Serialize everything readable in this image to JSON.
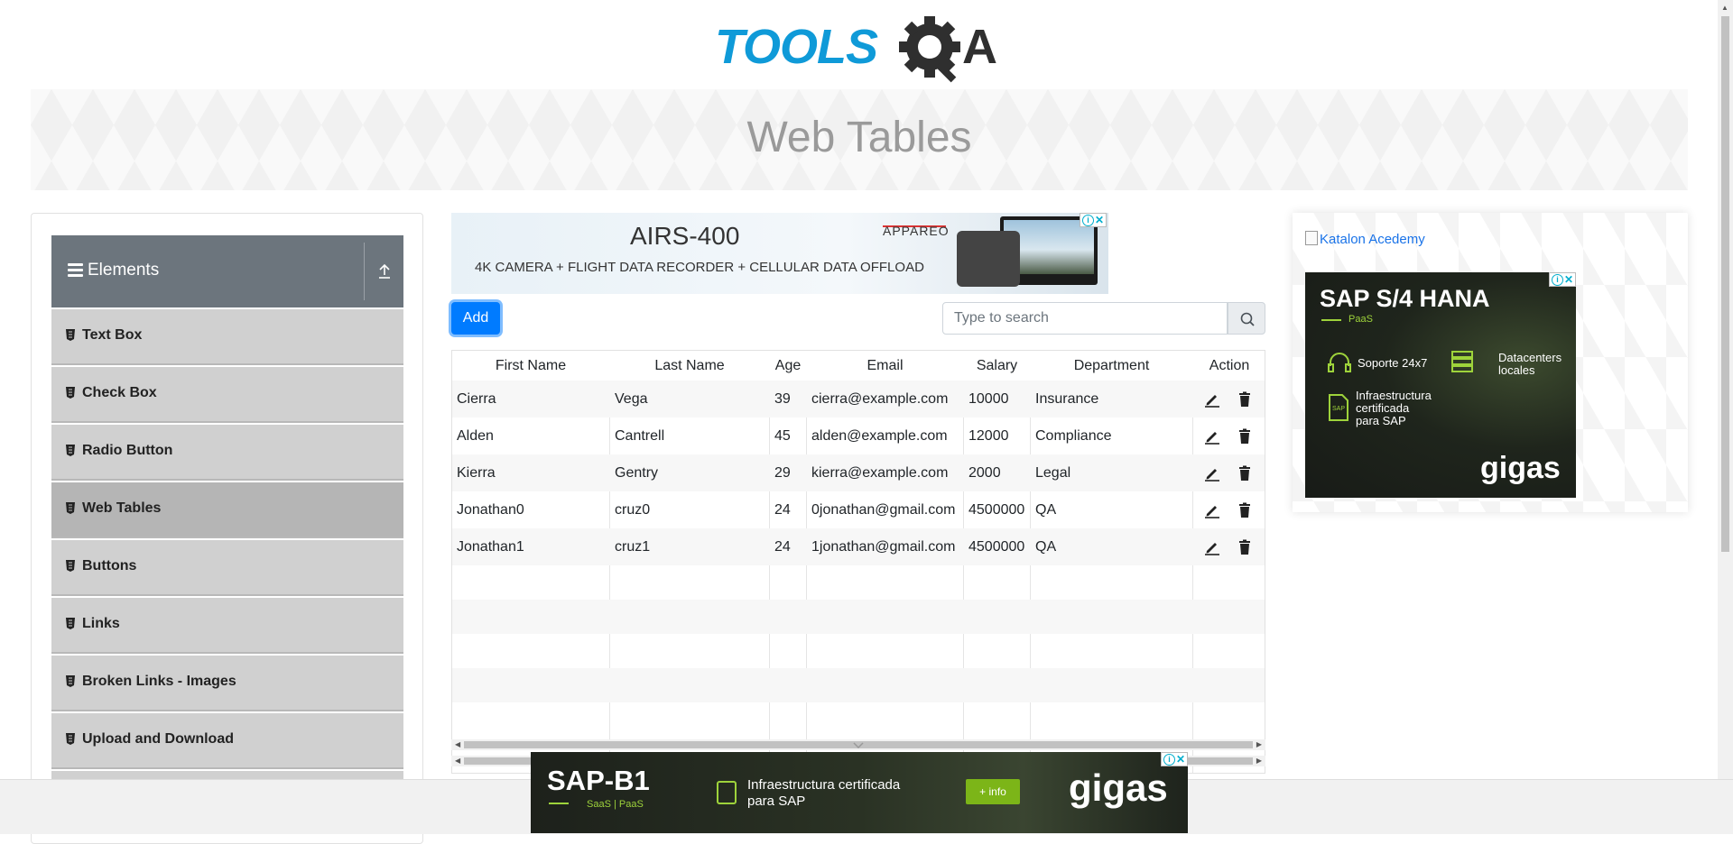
{
  "header": {
    "logo_text_left": "TOOLS",
    "logo_text_right": "A"
  },
  "banner": {
    "title": "Web Tables"
  },
  "sidebar": {
    "group_title": "Elements",
    "items": [
      {
        "label": "Text Box"
      },
      {
        "label": "Check Box"
      },
      {
        "label": "Radio Button"
      },
      {
        "label": "Web Tables",
        "active": true
      },
      {
        "label": "Buttons"
      },
      {
        "label": "Links"
      },
      {
        "label": "Broken Links - Images"
      },
      {
        "label": "Upload and Download"
      }
    ]
  },
  "ad_top": {
    "title": "AIRS-400",
    "subtitle": "4K CAMERA + FLIGHT DATA RECORDER + CELLULAR DATA OFFLOAD",
    "brand": "APPAREO"
  },
  "toolbar": {
    "add_label": "Add",
    "search_placeholder": "Type to search"
  },
  "table": {
    "columns": [
      "First Name",
      "Last Name",
      "Age",
      "Email",
      "Salary",
      "Department",
      "Action"
    ],
    "rows": [
      [
        "Cierra",
        "Vega",
        "39",
        "cierra@example.com",
        "10000",
        "Insurance"
      ],
      [
        "Alden",
        "Cantrell",
        "45",
        "alden@example.com",
        "12000",
        "Compliance"
      ],
      [
        "Kierra",
        "Gentry",
        "29",
        "kierra@example.com",
        "2000",
        "Legal"
      ],
      [
        "Jonathan0",
        "cruz0",
        "24",
        "0jonathan@gmail.com",
        "4500000",
        "QA"
      ],
      [
        "Jonathan1",
        "cruz1",
        "24",
        "1jonathan@gmail.com",
        "4500000",
        "QA"
      ]
    ],
    "empty_rows": 5
  },
  "right_ad": {
    "link_text": "Katalon Acedemy",
    "title": "SAP S/4 HANA",
    "tag": "PaaS",
    "feature1": "Soporte 24x7",
    "feature2a": "Datacenters",
    "feature2b": "locales",
    "feature3a": "Infraestructura",
    "feature3b": "certificada",
    "feature3c": "para SAP",
    "brand": "gigas"
  },
  "bottom_ad": {
    "title": "SAP-B1",
    "tag": "SaaS | PaaS",
    "text1": "Infraestructura certificada",
    "text2": "para SAP",
    "button": "+ info",
    "brand": "gigas"
  },
  "colors": {
    "primary": "#007bff",
    "sidebar_header": "#6c757d",
    "accent_green": "#9ed33b",
    "logo_blue": "#0f9ad8"
  }
}
